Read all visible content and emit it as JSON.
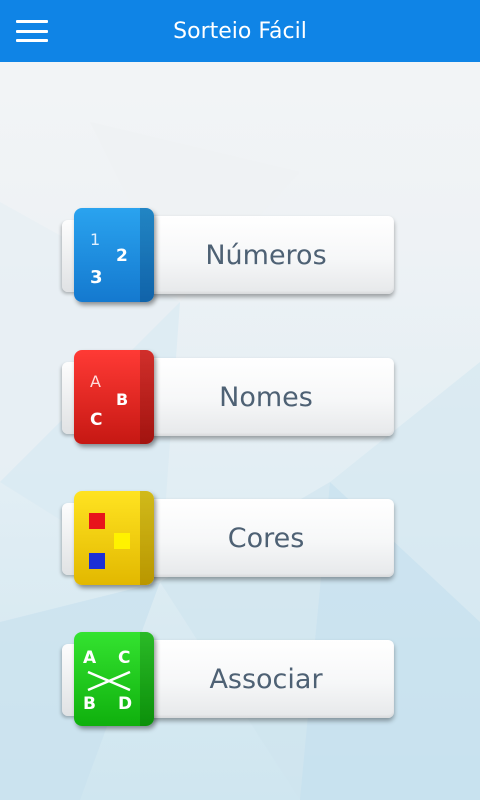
{
  "app_bar": {
    "title": "Sorteio Fácil",
    "menu_icon": "hamburger-menu-icon",
    "color": "#0f84e6"
  },
  "menu_items": [
    {
      "label": "Números",
      "icon": "numbers-icon",
      "icon_text": [
        "1",
        "2",
        "3"
      ],
      "color": "#1a88dd"
    },
    {
      "label": "Nomes",
      "icon": "letters-icon",
      "icon_text": [
        "A",
        "B",
        "C"
      ],
      "color": "#e02a25"
    },
    {
      "label": "Cores",
      "icon": "color-squares-icon",
      "icon_colors": [
        "#e8141b",
        "#fff200",
        "#1b2fd6"
      ],
      "color": "#f3cd10"
    },
    {
      "label": "Associar",
      "icon": "associate-icon",
      "icon_text": [
        "A",
        "C",
        "B",
        "D"
      ],
      "color": "#1ecc1c"
    }
  ]
}
